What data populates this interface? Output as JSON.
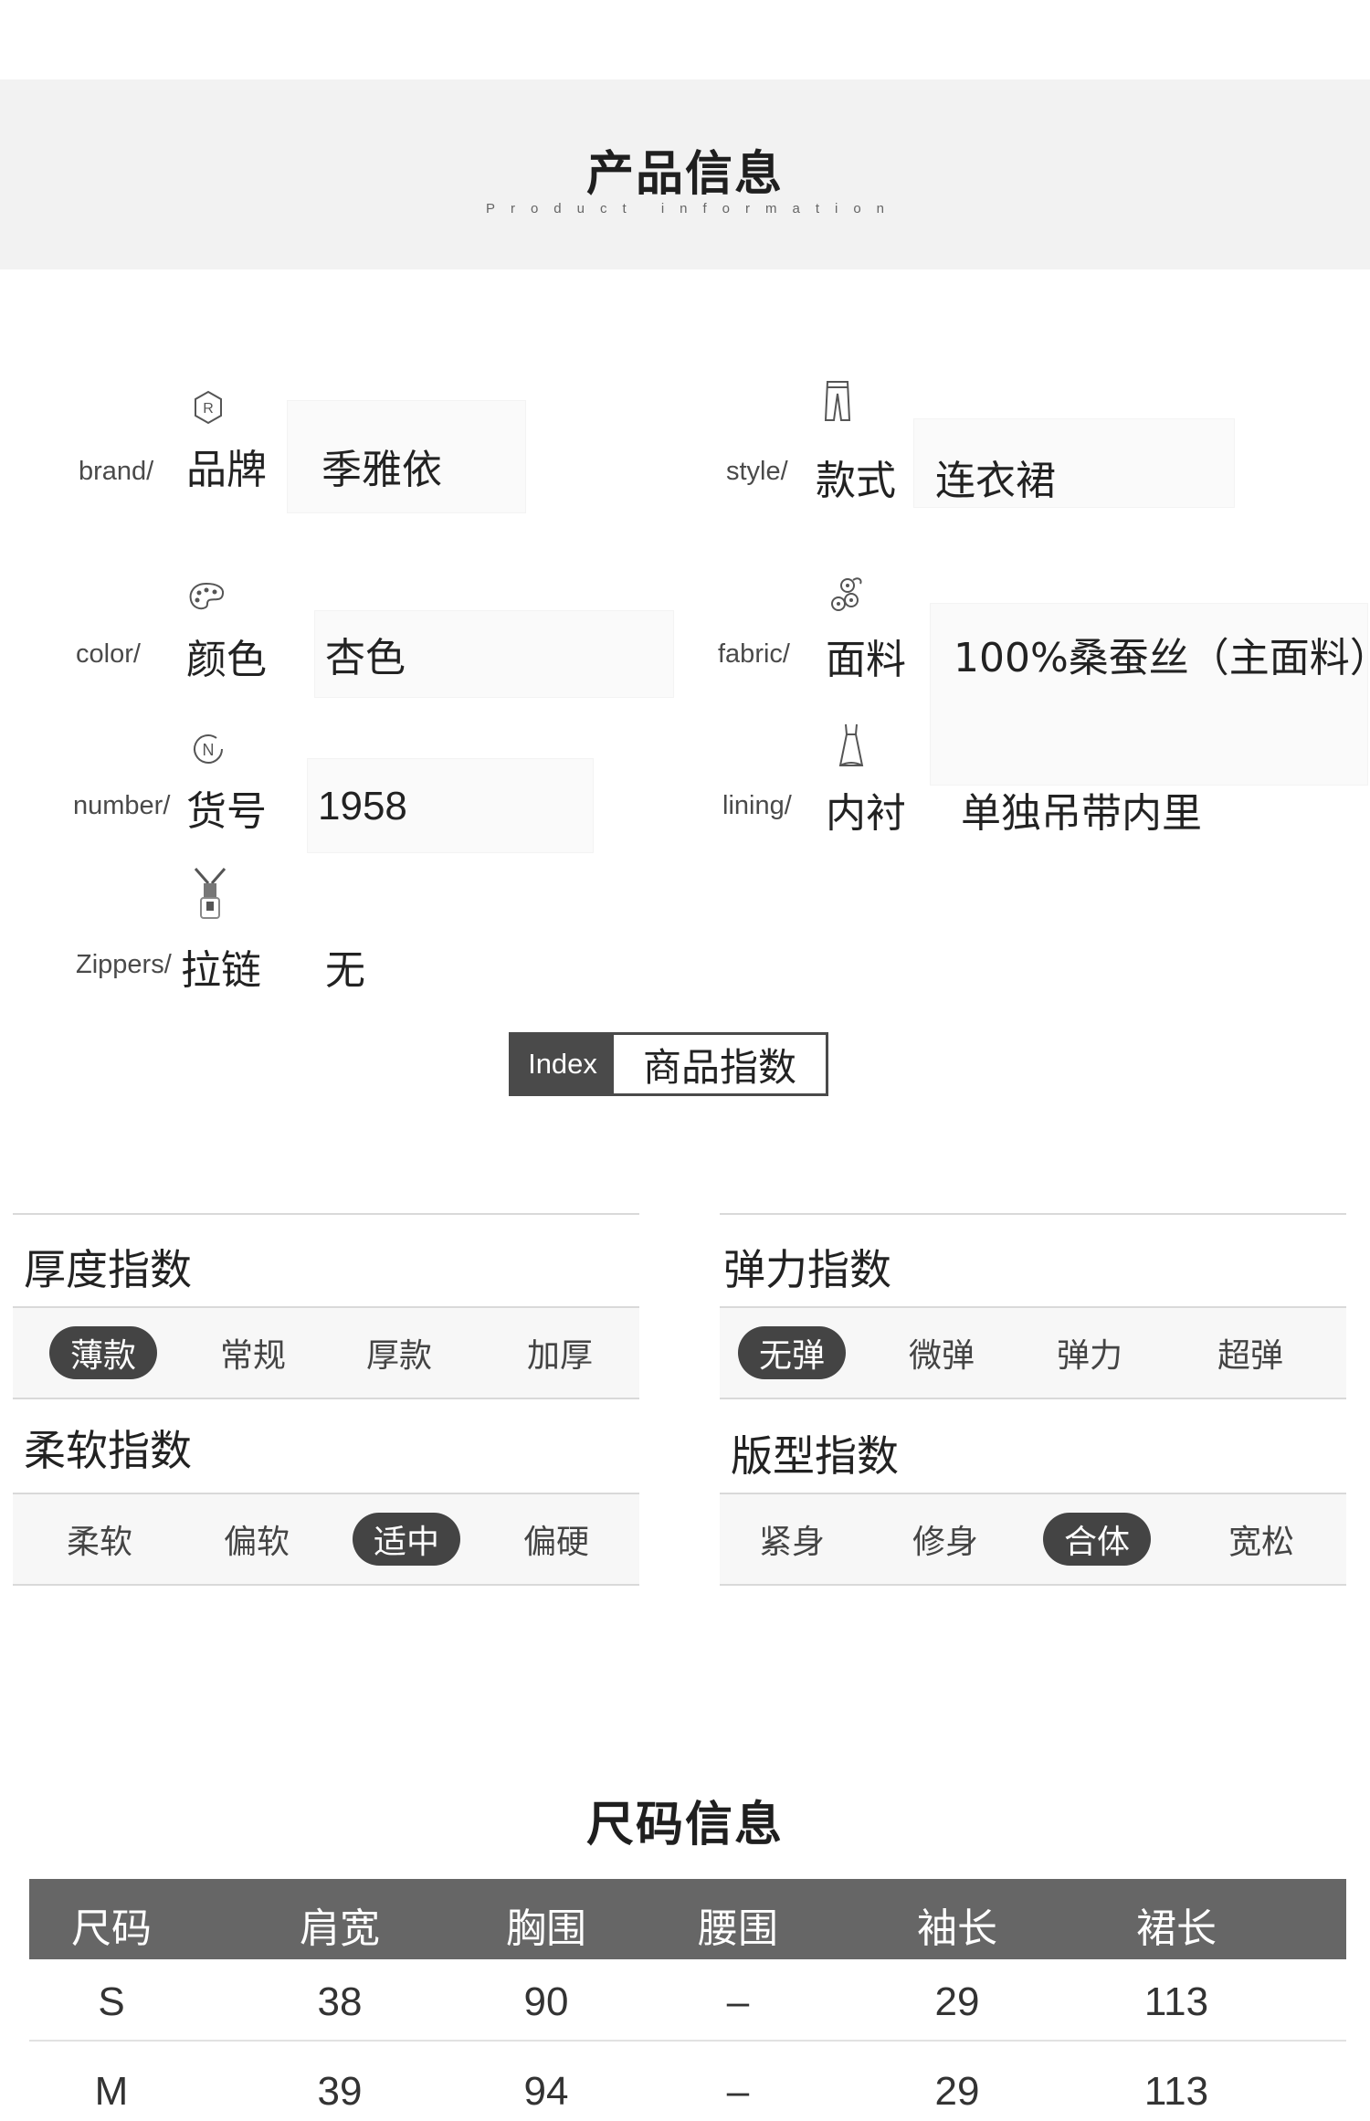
{
  "header": {
    "title": "产品信息",
    "subtitle": "Product information"
  },
  "attributes": {
    "brand": {
      "en": "brand/",
      "cn": "品牌",
      "value": "季雅依",
      "icon": "registered-icon"
    },
    "style": {
      "en": "style/",
      "cn": "款式",
      "value": "连衣裙",
      "icon": "pants-icon"
    },
    "color": {
      "en": "color/",
      "cn": "颜色",
      "value": "杏色",
      "icon": "palette-icon"
    },
    "fabric": {
      "en": "fabric/",
      "cn": "面料",
      "value": "100%桑蚕丝（主面料）",
      "icon": "thread-spools-icon"
    },
    "number": {
      "en": "number/",
      "cn": "货号",
      "value": "1958",
      "icon": "number-circle-icon"
    },
    "lining": {
      "en": "lining/",
      "cn": "内衬",
      "value": "单独吊带内里",
      "icon": "dress-icon"
    },
    "zippers": {
      "en": "Zippers/",
      "cn": "拉链",
      "value": "无",
      "icon": "zipper-icon"
    }
  },
  "index_badge": {
    "left": "Index",
    "right": "商品指数"
  },
  "panels": {
    "thickness": {
      "title": "厚度指数",
      "options": [
        "薄款",
        "常规",
        "厚款",
        "加厚"
      ],
      "selected": 0
    },
    "elasticity": {
      "title": "弹力指数",
      "options": [
        "无弹",
        "微弹",
        "弹力",
        "超弹"
      ],
      "selected": 0
    },
    "softness": {
      "title": "柔软指数",
      "options": [
        "柔软",
        "偏软",
        "适中",
        "偏硬"
      ],
      "selected": 2
    },
    "fit": {
      "title": "版型指数",
      "options": [
        "紧身",
        "修身",
        "合体",
        "宽松"
      ],
      "selected": 2
    }
  },
  "size_info": {
    "title": "尺码信息",
    "headers": [
      "尺码",
      "肩宽",
      "胸围",
      "腰围",
      "袖长",
      "裙长"
    ],
    "rows": [
      [
        "S",
        "38",
        "90",
        "–",
        "29",
        "113"
      ],
      [
        "M",
        "39",
        "94",
        "–",
        "29",
        "113"
      ]
    ]
  },
  "colors": {
    "accent_dark": "#444444",
    "band": "#f2f2f2"
  }
}
